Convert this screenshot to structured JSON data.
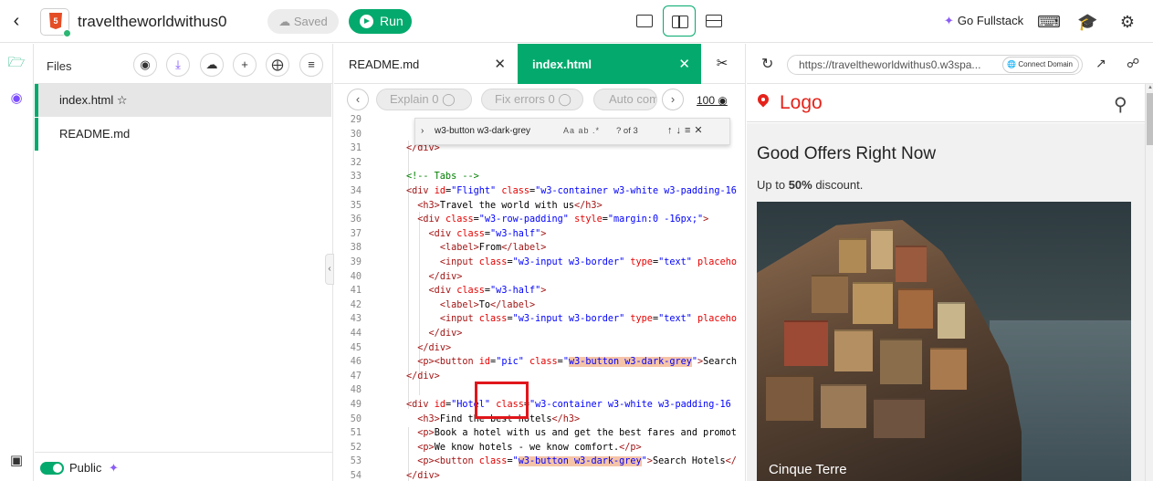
{
  "header": {
    "project_name": "traveltheworldwithus0",
    "saved_label": "Saved",
    "run_label": "Run",
    "go_fullstack_label": "Go Fullstack",
    "html_badge": "5"
  },
  "files_panel": {
    "title": "Files",
    "files": [
      {
        "name": "index.html",
        "active": true
      },
      {
        "name": "README.md",
        "active": false
      }
    ],
    "public_label": "Public"
  },
  "editor": {
    "tabs": [
      {
        "label": "README.md",
        "active": false
      },
      {
        "label": "index.html",
        "active": true
      }
    ],
    "ai_buttons": [
      {
        "label": "Explain",
        "count": "0"
      },
      {
        "label": "Fix errors",
        "count": "0"
      },
      {
        "label": "Auto com",
        "count": ""
      }
    ],
    "ai_credits": "100",
    "find": {
      "query": "w3-button w3-dark-grey",
      "options": "Aa ab .*",
      "result_count": "? of 3"
    },
    "lines": [
      {
        "n": "29",
        "html": ""
      },
      {
        "n": "30",
        "html": ""
      },
      {
        "n": "31",
        "html": "<span class='tag'>&lt;/div&gt;</span>"
      },
      {
        "n": "32",
        "html": ""
      },
      {
        "n": "33",
        "html": "<span class='com'>&lt;!-- Tabs --&gt;</span>"
      },
      {
        "n": "34",
        "html": "<span class='tag'>&lt;div</span> <span class='att'>id</span>=<span class='val'>\"Flight\"</span> <span class='att'>class</span>=<span class='val'>\"w3-container w3-white w3-padding-16</span>"
      },
      {
        "n": "35",
        "html": "  <span class='tag'>&lt;h3&gt;</span>Travel the world with us<span class='tag'>&lt;/h3&gt;</span>"
      },
      {
        "n": "36",
        "html": "  <span class='tag'>&lt;div</span> <span class='att'>class</span>=<span class='val'>\"w3-row-padding\"</span> <span class='att'>style</span>=<span class='val'>\"margin:0 -16px;\"</span><span class='tag'>&gt;</span>"
      },
      {
        "n": "37",
        "html": "    <span class='tag'>&lt;div</span> <span class='att'>class</span>=<span class='val'>\"w3-half\"</span><span class='tag'>&gt;</span>"
      },
      {
        "n": "38",
        "html": "      <span class='tag'>&lt;label&gt;</span>From<span class='tag'>&lt;/label&gt;</span>"
      },
      {
        "n": "39",
        "html": "      <span class='tag'>&lt;input</span> <span class='att'>class</span>=<span class='val'>\"w3-input w3-border\"</span> <span class='att'>type</span>=<span class='val'>\"text\"</span> <span class='att'>placeho</span>"
      },
      {
        "n": "40",
        "html": "    <span class='tag'>&lt;/div&gt;</span>"
      },
      {
        "n": "41",
        "html": "    <span class='tag'>&lt;div</span> <span class='att'>class</span>=<span class='val'>\"w3-half\"</span><span class='tag'>&gt;</span>"
      },
      {
        "n": "42",
        "html": "      <span class='tag'>&lt;label&gt;</span>To<span class='tag'>&lt;/label&gt;</span>"
      },
      {
        "n": "43",
        "html": "      <span class='tag'>&lt;input</span> <span class='att'>class</span>=<span class='val'>\"w3-input w3-border\"</span> <span class='att'>type</span>=<span class='val'>\"text\"</span> <span class='att'>placeho</span>"
      },
      {
        "n": "44",
        "html": "    <span class='tag'>&lt;/div&gt;</span>"
      },
      {
        "n": "45",
        "html": "  <span class='tag'>&lt;/div&gt;</span>"
      },
      {
        "n": "46",
        "html": "  <span class='tag'>&lt;p&gt;&lt;button</span> <span class='att'>id</span>=<span class='val'>\"pic\"</span> <span class='att'>class</span>=<span class='val'>\"<span class='hl'>w3-button w3-dark-grey</span>\"</span><span class='tag'>&gt;</span>Search"
      },
      {
        "n": "47",
        "html": "<span class='tag'>&lt;/div&gt;</span>"
      },
      {
        "n": "48",
        "html": ""
      },
      {
        "n": "49",
        "html": "<span class='tag'>&lt;div</span> <span class='att'>id</span>=<span class='val'>\"Hotel\"</span> <span class='att'>class</span>=<span class='val'>\"w3-container w3-white w3-padding-16</span>"
      },
      {
        "n": "50",
        "html": "  <span class='tag'>&lt;h3&gt;</span>Find the best hotels<span class='tag'>&lt;/h3&gt;</span>"
      },
      {
        "n": "51",
        "html": "  <span class='tag'>&lt;p&gt;</span>Book a hotel with us and get the best fares and promot"
      },
      {
        "n": "52",
        "html": "  <span class='tag'>&lt;p&gt;</span>We know hotels - we know comfort.<span class='tag'>&lt;/p&gt;</span>"
      },
      {
        "n": "53",
        "html": "  <span class='tag'>&lt;p&gt;&lt;button</span> <span class='att'>class</span>=<span class='val'>\"<span class='hl'>w3-button w3-dark-grey</span>\"</span><span class='tag'>&gt;</span>Search Hotels<span class='tag'>&lt;/</span>"
      },
      {
        "n": "54",
        "html": "<span class='tag'>&lt;/div&gt;</span>"
      }
    ]
  },
  "preview": {
    "url": "https://traveltheworldwithus0.w3spa...",
    "connect_domain_label": "Connect Domain",
    "site": {
      "logo": "Logo",
      "heading": "Good Offers Right Now",
      "sub_prefix": "Up to ",
      "sub_bold": "50%",
      "sub_suffix": " discount.",
      "caption": "Cinque Terre"
    }
  }
}
